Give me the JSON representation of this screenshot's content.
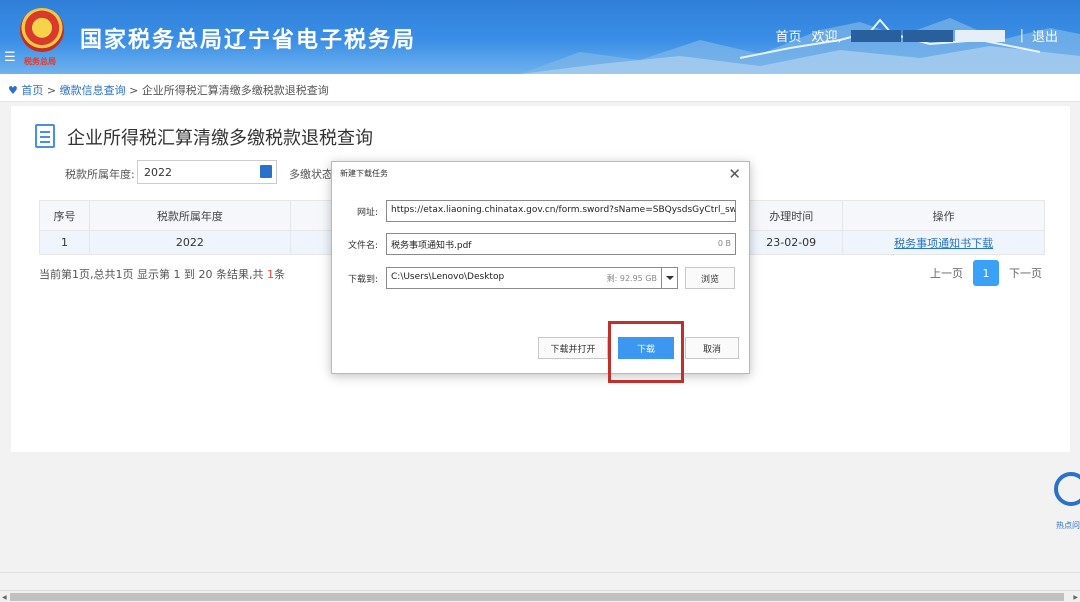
{
  "header": {
    "site_title": "国家税务总局辽宁省电子税务局",
    "emblem_sub": "税务总局",
    "menu_icon": "☰",
    "home": "首页",
    "welcome": "欢迎,",
    "sep": "|",
    "logout": "退出"
  },
  "breadcrumb": {
    "home": "首页",
    "sep1": ">",
    "level1": "缴款信息查询",
    "sep2": ">",
    "current": "企业所得税汇算清缴多缴税款退税查询"
  },
  "page": {
    "title": "企业所得税汇算清缴多缴税款退税查询",
    "year_label": "税款所属年度:",
    "year_value": "2022",
    "status_label": "多缴状态"
  },
  "table": {
    "headers": [
      "序号",
      "税款所属年度",
      "",
      "",
      "办理时间",
      "操作"
    ],
    "rows": [
      {
        "index": "1",
        "year": "2022",
        "date": "23-02-09",
        "action": "税务事项通知书下载"
      }
    ]
  },
  "pager": {
    "info_prefix": "当前第1页,总共1页   显示第 1 到 20 条结果,共 ",
    "info_count": "1",
    "info_suffix": "条",
    "prev": "上一页",
    "current": "1",
    "next": "下一页"
  },
  "dialog": {
    "title": "新建下载任务",
    "close": "✕",
    "url_label": "网址:",
    "url_value": "https://etax.liaoning.chinatax.gov.cn/form.sword?sName=SBQysdsGyCtrl_swsxtzs:",
    "filename_label": "文件名:",
    "filename_value": "税务事项通知书.pdf",
    "filename_size": "0 B",
    "saveto_label": "下载到:",
    "saveto_value": "C:\\Users\\Lenovo\\Desktop",
    "free_space": "剩: 92.95 GB",
    "browse": "浏览",
    "download_open": "下载并打开",
    "download": "下载",
    "cancel": "取消"
  },
  "hot": {
    "label": "热点问"
  },
  "colors": {
    "accent": "#3c97f0",
    "highlight": "#c0302a",
    "header": "#3b8fe6"
  }
}
